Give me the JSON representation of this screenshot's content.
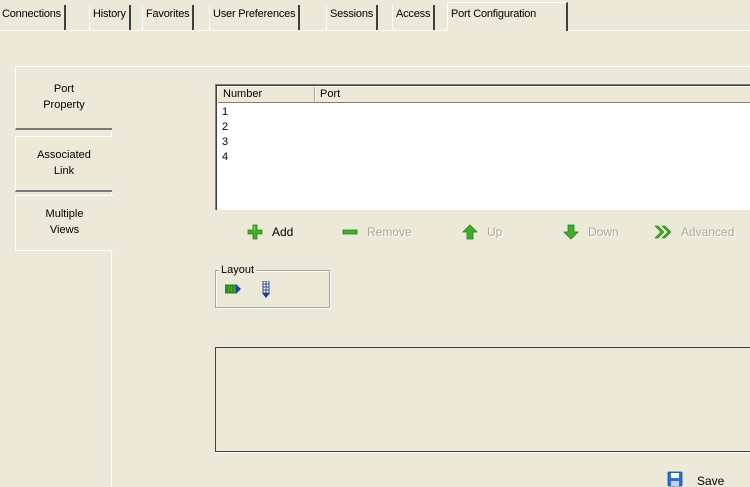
{
  "tabs": [
    {
      "label": "Connections",
      "active": false
    },
    {
      "label": "History",
      "active": false
    },
    {
      "label": "Favorites",
      "active": false
    },
    {
      "label": "User Preferences",
      "active": false
    },
    {
      "label": "Sessions",
      "active": false
    },
    {
      "label": "Access",
      "active": false
    },
    {
      "label": "Port Configuration",
      "active": true
    }
  ],
  "side_tabs": [
    {
      "line1": "Port",
      "line2": "Property",
      "active": false
    },
    {
      "line1": "Associated",
      "line2": "Link",
      "active": false
    },
    {
      "line1": "Multiple",
      "line2": "Views",
      "active": true
    }
  ],
  "port_list": {
    "columns": [
      "Number",
      "Port"
    ],
    "rows": [
      {
        "number": "1",
        "port": ""
      },
      {
        "number": "2",
        "port": ""
      },
      {
        "number": "3",
        "port": ""
      },
      {
        "number": "4",
        "port": ""
      }
    ]
  },
  "actions": [
    {
      "label": "Add",
      "icon": "plus-icon",
      "enabled": true
    },
    {
      "label": "Remove",
      "icon": "minus-icon",
      "enabled": false
    },
    {
      "label": "Up",
      "icon": "arrow-up-icon",
      "enabled": false
    },
    {
      "label": "Down",
      "icon": "arrow-down-icon",
      "enabled": false
    },
    {
      "label": "Advanced",
      "icon": "double-chevron-icon",
      "enabled": false
    }
  ],
  "layout": {
    "title": "Layout",
    "options": [
      "horizontal-layout-icon",
      "vertical-layout-icon"
    ]
  },
  "save": {
    "label": "Save",
    "icon": "floppy-disk-icon"
  },
  "colors": {
    "background": "#ece9d8",
    "icon_green": "#3fae2a",
    "disabled_text": "#aca899",
    "save_icon_blue": "#2f6fcf"
  }
}
